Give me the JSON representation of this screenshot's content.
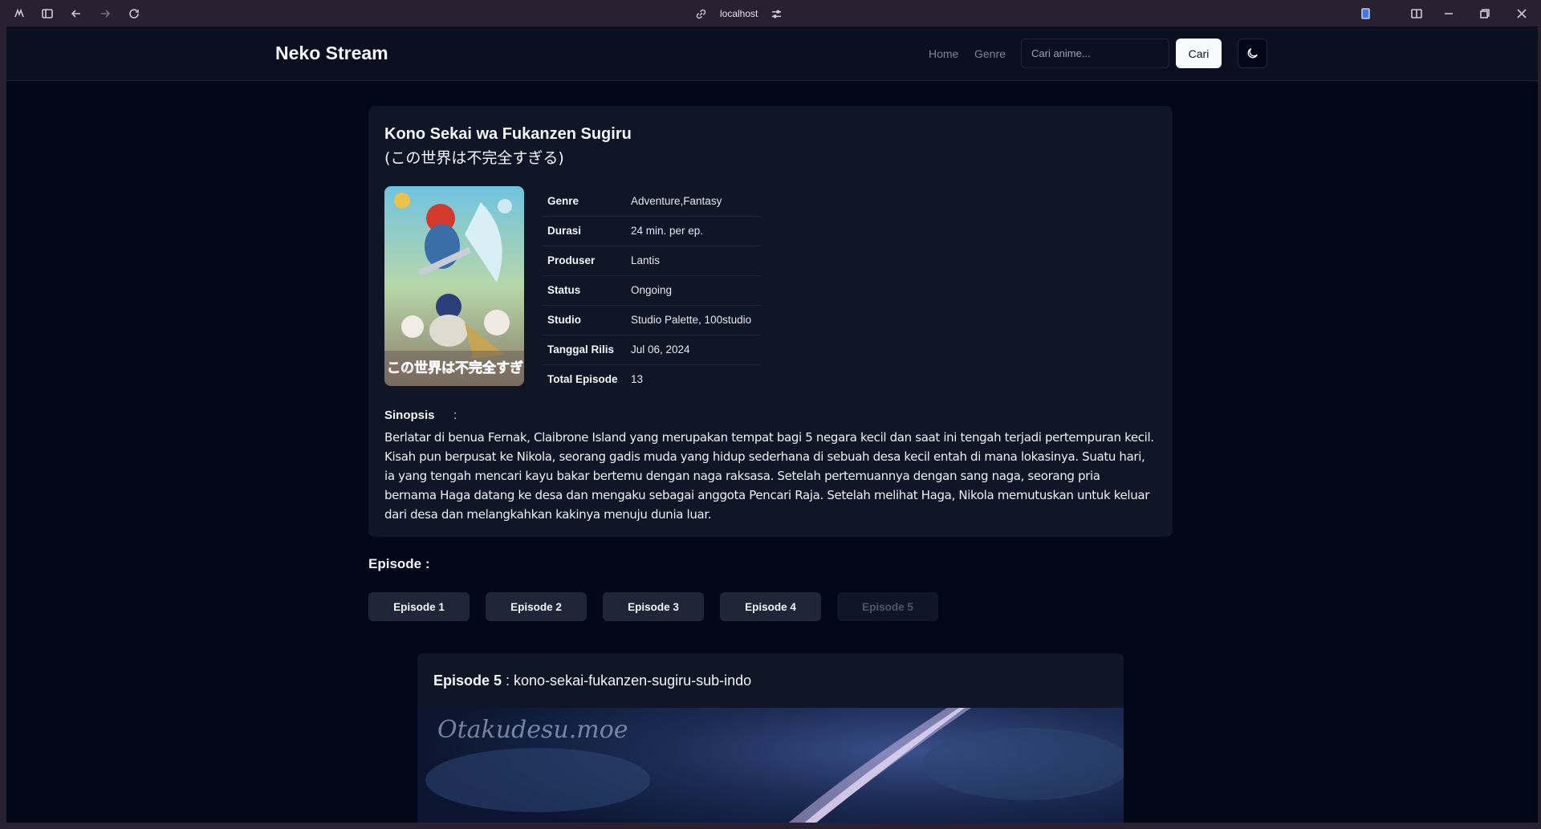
{
  "browser": {
    "url": "localhost"
  },
  "header": {
    "brand": "Neko Stream",
    "nav": [
      {
        "label": "Home"
      },
      {
        "label": "Genre"
      }
    ],
    "search_placeholder": "Cari anime...",
    "search_button": "Cari",
    "theme_icon": "moon-icon"
  },
  "anime": {
    "title": "Kono Sekai wa Fukanzen Sugiru",
    "title_jp": "(この世界は不完全すぎる)",
    "details": [
      {
        "key": "Genre",
        "value": "Adventure,Fantasy"
      },
      {
        "key": "Durasi",
        "value": "24 min. per ep."
      },
      {
        "key": "Produser",
        "value": "Lantis"
      },
      {
        "key": "Status",
        "value": "Ongoing"
      },
      {
        "key": "Studio",
        "value": "Studio Palette, 100studio"
      },
      {
        "key": "Tanggal Rilis",
        "value": "Jul 06, 2024"
      },
      {
        "key": "Total Episode",
        "value": "13"
      }
    ],
    "synopsis_label": "Sinopsis",
    "synopsis_colon": ":",
    "synopsis": "Berlatar di benua Fernak, Claibrone Island yang merupakan tempat bagi 5 negara kecil dan saat ini tengah terjadi pertempuran kecil. Kisah pun berpusat ke Nikola, seorang gadis muda yang hidup sederhana di sebuah desa kecil entah di mana lokasinya. Suatu hari, ia yang tengah mencari kayu bakar bertemu dengan naga raksasa. Setelah pertemuannya dengan sang naga, seorang pria bernama Haga datang ke desa dan mengaku sebagai anggota Pencari Raja. Setelah melihat Haga, Nikola memutuskan untuk keluar dari desa dan melangkahkan kakinya menuju dunia luar.",
    "poster_text": "この世界は不完全すぎる"
  },
  "episodes": {
    "heading": "Episode  :",
    "items": [
      {
        "label": "Episode 1",
        "active": true
      },
      {
        "label": "Episode 2",
        "active": true
      },
      {
        "label": "Episode 3",
        "active": true
      },
      {
        "label": "Episode 4",
        "active": true
      },
      {
        "label": "Episode 5",
        "active": false
      }
    ]
  },
  "player": {
    "episode_label": "Episode 5",
    "slug": " : kono-sekai-fukanzen-sugiru-sub-indo",
    "watermark": "Otakudesu.moe"
  }
}
